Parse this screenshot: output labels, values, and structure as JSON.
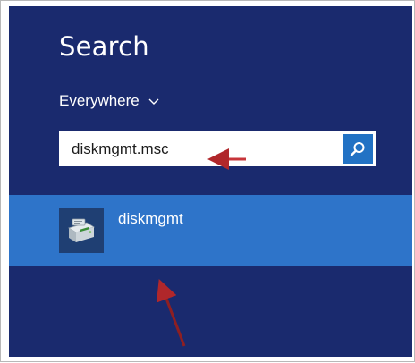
{
  "search_pane": {
    "title": "Search",
    "scope_label": "Everywhere",
    "scope_icon": "chevron-down-icon",
    "query_value": "diskmgmt.msc",
    "submit_icon": "magnifier-icon"
  },
  "results": [
    {
      "label": "diskmgmt",
      "icon": "disk-management-icon"
    }
  ],
  "colors": {
    "panel_bg": "#1a2a6e",
    "result_highlight": "#2e74c9",
    "search_button": "#2272c4",
    "annotation_arrow": "#b0272b"
  }
}
